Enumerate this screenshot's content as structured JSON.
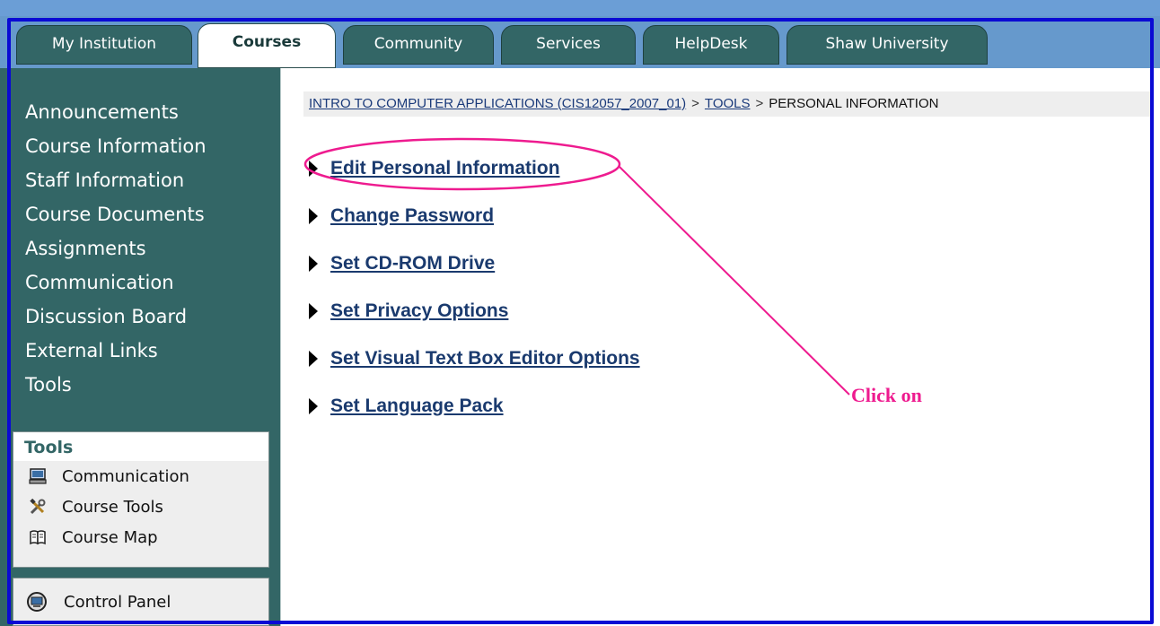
{
  "tabs": [
    {
      "label": "My Institution"
    },
    {
      "label": "Courses"
    },
    {
      "label": "Community"
    },
    {
      "label": "Services"
    },
    {
      "label": "HelpDesk"
    },
    {
      "label": "Shaw University"
    }
  ],
  "sidebar": {
    "items": [
      {
        "label": "Announcements"
      },
      {
        "label": "Course Information"
      },
      {
        "label": "Staff Information"
      },
      {
        "label": "Course Documents"
      },
      {
        "label": "Assignments"
      },
      {
        "label": "Communication"
      },
      {
        "label": "Discussion Board"
      },
      {
        "label": "External Links"
      },
      {
        "label": "Tools"
      }
    ],
    "tools_box": {
      "title": "Tools",
      "items": [
        {
          "label": "Communication",
          "icon": "computer-icon"
        },
        {
          "label": "Course Tools",
          "icon": "tools-icon"
        },
        {
          "label": "Course Map",
          "icon": "book-icon"
        }
      ]
    },
    "control_panel": {
      "label": "Control Panel",
      "icon": "control-panel-icon"
    }
  },
  "breadcrumb": {
    "course": "INTRO TO COMPUTER APPLICATIONS (CIS12057_2007_01)",
    "tools": "TOOLS",
    "current": "PERSONAL INFORMATION",
    "separator": ">"
  },
  "main": {
    "links": [
      {
        "label": "Edit Personal Information"
      },
      {
        "label": "Change Password"
      },
      {
        "label": "Set CD-ROM Drive"
      },
      {
        "label": "Set Privacy Options"
      },
      {
        "label": "Set Visual Text Box Editor Options"
      },
      {
        "label": "Set Language Pack"
      }
    ]
  },
  "annotation": {
    "text": "Click on",
    "color": "#ee1b8f"
  },
  "colors": {
    "tab_bar": "#6699cc",
    "sidebar": "#336666",
    "frame": "#0a0ad4",
    "link": "#1a3a6e"
  }
}
